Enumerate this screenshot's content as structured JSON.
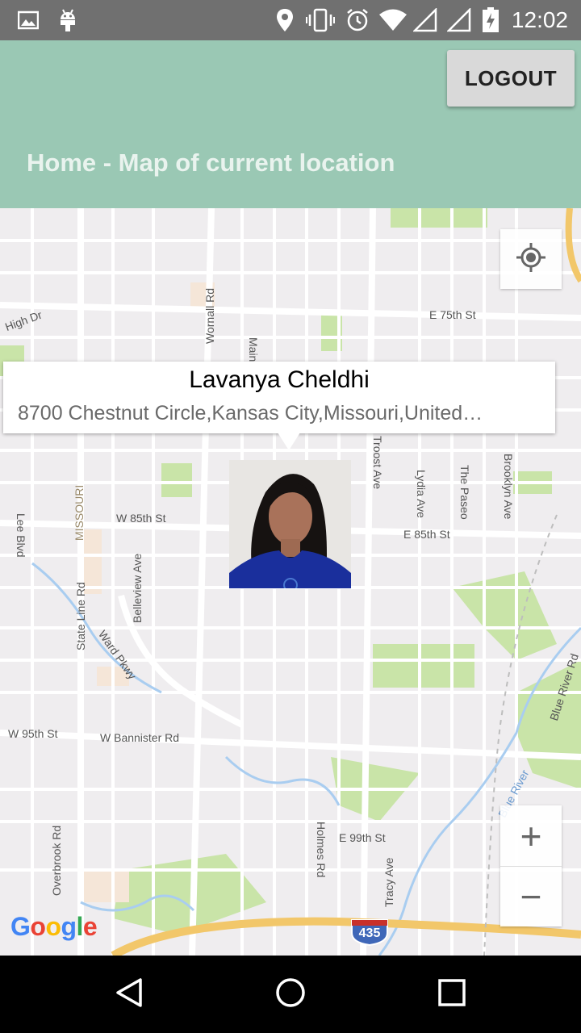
{
  "status_bar": {
    "time": "12:02",
    "icons": [
      "image-icon",
      "android-icon",
      "location-icon",
      "vibrate-icon",
      "alarm-icon",
      "wifi-icon",
      "signal-icon",
      "signal-icon",
      "battery-icon"
    ]
  },
  "app_bar": {
    "logout_label": "LOGOUT",
    "title": "Home - Map of current location",
    "color": "#9ac8b4"
  },
  "map": {
    "info_window": {
      "name": "Lavanya Cheldhi",
      "address": "8700 Chestnut Circle,Kansas City,Missouri,United…"
    },
    "street_labels": {
      "high_dr": "High Dr",
      "e_75th": "E 75th St",
      "wornall": "Wornall Rd",
      "main": "Main",
      "troost": "Troost Ave",
      "lydia": "Lydia Ave",
      "paseo": "The Paseo",
      "brooklyn": "Brooklyn Ave",
      "missouri": "MISSOURI",
      "lee": "Lee Blvd",
      "w_85th": "W 85th St",
      "e_85th": "E 85th St",
      "belleview": "Belleview Ave",
      "state_line": "State Line Rd",
      "ward": "Ward Pkwy",
      "blue_river_rd": "Blue River Rd",
      "w_95th": "W 95th St",
      "bannister": "W Bannister Rd",
      "blue_river": "Blue River",
      "e_99th": "E 99th St",
      "overbrook": "Overbrook Rd",
      "holmes": "Holmes Rd",
      "tracy": "Tracy Ave",
      "interstate": "435"
    },
    "zoom_in_label": "+",
    "zoom_out_label": "−",
    "google_logo": [
      "G",
      "o",
      "o",
      "g",
      "l",
      "e"
    ]
  },
  "nav_bar": {
    "icons": [
      "back-icon",
      "home-icon",
      "recents-icon"
    ]
  }
}
